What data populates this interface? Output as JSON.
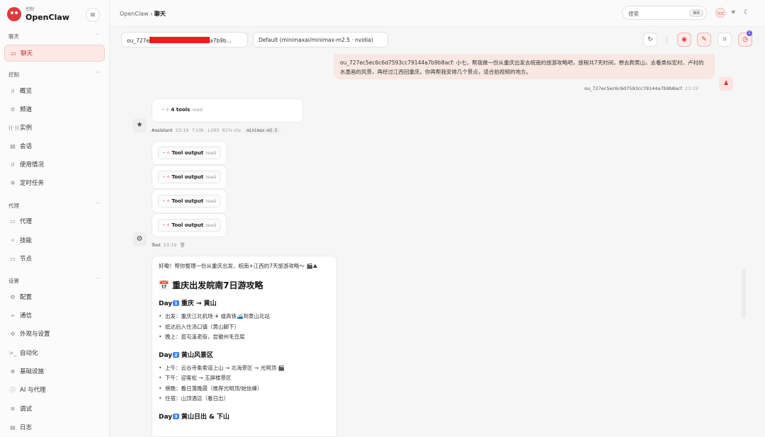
{
  "brand": {
    "subtitle": "控制",
    "name": "OpenClaw"
  },
  "sidebar": {
    "sections": [
      {
        "label": "聊天",
        "items": [
          {
            "label": "聊天",
            "icon": "chat-icon",
            "glyph": "▭",
            "active": true
          }
        ]
      },
      {
        "label": "控制",
        "items": [
          {
            "label": "概览",
            "icon": "bar-chart-icon",
            "glyph": "ıl"
          },
          {
            "label": "频道",
            "icon": "link-icon",
            "glyph": "⊘"
          },
          {
            "label": "实例",
            "icon": "radio-icon",
            "glyph": "((·))"
          },
          {
            "label": "会话",
            "icon": "file-icon",
            "glyph": "▤"
          },
          {
            "label": "使用情况",
            "icon": "usage-icon",
            "glyph": "ıl"
          },
          {
            "label": "定时任务",
            "icon": "loader-icon",
            "glyph": "✲"
          }
        ]
      },
      {
        "label": "代理",
        "items": [
          {
            "label": "代理",
            "icon": "folder-icon",
            "glyph": "▭"
          },
          {
            "label": "技能",
            "icon": "sparkle-icon",
            "glyph": "✧"
          },
          {
            "label": "节点",
            "icon": "monitor-icon",
            "glyph": "▭"
          }
        ]
      },
      {
        "label": "设置",
        "items": [
          {
            "label": "配置",
            "icon": "gear-icon",
            "glyph": "⚙"
          },
          {
            "label": "通信",
            "icon": "send-icon",
            "glyph": "➢"
          },
          {
            "label": "外观与设置",
            "icon": "sun-icon",
            "glyph": "✣"
          },
          {
            "label": "自动化",
            "icon": "terminal-icon",
            "glyph": ">_"
          },
          {
            "label": "基础设施",
            "icon": "globe-icon",
            "glyph": "⊕"
          },
          {
            "label": "AI 与代理",
            "icon": "ai-icon",
            "glyph": "ⓘ"
          },
          {
            "label": "调试",
            "icon": "bug-icon",
            "glyph": "✲"
          },
          {
            "label": "日志",
            "icon": "log-icon",
            "glyph": "▤"
          }
        ]
      }
    ]
  },
  "topbar": {
    "crumb_root": "OpenClaw",
    "crumb_sep": "›",
    "crumb_current": "聊天",
    "search_placeholder": "搜索",
    "search_kbd": "⌘K",
    "theme_icons": [
      "▭",
      "☀",
      "☾"
    ]
  },
  "session": {
    "key_prefix": "ou_727e",
    "key_suffix": "a7b9b...",
    "model": "Default (minimaxai/minimax-m2.5 · nvidia)",
    "refresh_glyph": "↻",
    "sep_glyph": "|",
    "btn1_glyph": "◉",
    "btn2_glyph": "✎",
    "btn3_glyph": "⌗",
    "btn4_glyph": "◷",
    "badge": "1"
  },
  "user_message": {
    "text": "ou_727ec5ec6c6d7593cc79144a7b9b8acf: 小七，帮我做一份从重庆出发去皖南的旅游攻略吧，旅程共7天时间，想去爬黄山，去看类似宏村、卢村的水墨画的风景，再经过江西回重庆。你再帮我安排几个景点，适合拍视频的地方。",
    "sender": "ou_727ec5ec6c6d7593cc79144a7b9b8acf",
    "time": "23:19",
    "avatar_glyph": "♟"
  },
  "assistant": {
    "tools_prefix": "-",
    "tools_spark": "✧",
    "tools_label": "4 tools",
    "tools_tag": "read",
    "avatar_glyph": "★",
    "name": "Assistant",
    "time": "23:19",
    "up": "↑10k",
    "down": "↓265",
    "ctx": "61% ctx",
    "model": "minimax-m2.5"
  },
  "tool_outputs": [
    {
      "prefix": "-",
      "spark": "✧",
      "label": "Tool output",
      "tag": "read"
    },
    {
      "prefix": "-",
      "spark": "✧",
      "label": "Tool output",
      "tag": "read"
    },
    {
      "prefix": "-",
      "spark": "✧",
      "label": "Tool output",
      "tag": "read"
    },
    {
      "prefix": "-",
      "spark": "✧",
      "label": "Tool output",
      "tag": "read"
    }
  ],
  "tool": {
    "avatar_glyph": "⚙",
    "name": "Tool",
    "time": "23:19",
    "trash_glyph": "🗑"
  },
  "reply": {
    "intro": "好嘞！帮你整理一份从重庆出发、皖南+江西的7天旅游攻略～ 🎬⛰",
    "cal_glyph": "📅",
    "title": "重庆出发皖南7日游攻略",
    "day_word": "Day",
    "days": [
      {
        "num": "1",
        "heading": "重庆 → 黄山",
        "items": [
          "出发：重庆江北机场 ✈ 或高铁🚄到黄山北站",
          "抵达后入住汤口镇（黄山脚下）",
          "晚上：逛屯溪老街，尝徽州毛豆腐"
        ]
      },
      {
        "num": "2",
        "heading": "黄山风景区",
        "items": [
          "上午：云谷寺乘索道上山 → 北海景区 → 光明顶 🎬",
          "下午：迎客松 → 玉屏楼景区",
          "傍晚：看日落晚霞（推荐光明顶/始信峰）",
          "住宿：山顶酒店（看日出）"
        ]
      },
      {
        "num": "3",
        "heading": "黄山日出 & 下山",
        "items": []
      }
    ]
  }
}
